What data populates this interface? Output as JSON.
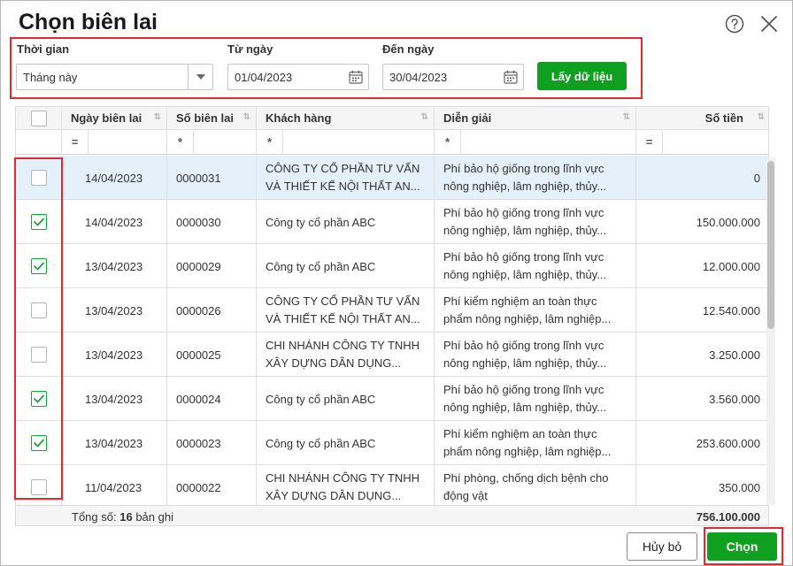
{
  "dialog": {
    "title": "Chọn biên lai",
    "help_icon": "help-circle-icon",
    "close_icon": "close-icon"
  },
  "filters": {
    "period_label": "Thời gian",
    "period_value": "Tháng này",
    "from_label": "Từ ngày",
    "from_value": "01/04/2023",
    "to_label": "Đến ngày",
    "to_value": "30/04/2023",
    "fetch_button": "Lấy dữ liệu"
  },
  "table": {
    "columns": [
      "Ngày biên lai",
      "Số biên lai",
      "Khách hàng",
      "Diễn giải",
      "Số tiền"
    ],
    "filter_ops": [
      "=",
      "*",
      "*",
      "*",
      "="
    ],
    "rows": [
      {
        "checked": false,
        "selected": true,
        "date": "14/04/2023",
        "number": "0000031",
        "customer": [
          "CÔNG TY CỔ PHẦN TƯ VẤN",
          "VÀ THIẾT KẾ NỘI THẤT AN..."
        ],
        "desc": [
          "Phí bảo hộ giống trong lĩnh vực",
          "nông nghiệp, lâm nghiệp, thủy..."
        ],
        "amount": "0"
      },
      {
        "checked": true,
        "selected": false,
        "date": "14/04/2023",
        "number": "0000030",
        "customer": [
          "Công ty cổ phần ABC"
        ],
        "desc": [
          "Phí bảo hộ giống trong lĩnh vực",
          "nông nghiệp, lâm nghiệp, thủy..."
        ],
        "amount": "150.000.000"
      },
      {
        "checked": true,
        "selected": false,
        "date": "13/04/2023",
        "number": "0000029",
        "customer": [
          "Công ty cổ phần ABC"
        ],
        "desc": [
          "Phí bảo hộ giống trong lĩnh vực",
          "nông nghiệp, lâm nghiệp, thủy..."
        ],
        "amount": "12.000.000"
      },
      {
        "checked": false,
        "selected": false,
        "date": "13/04/2023",
        "number": "0000026",
        "customer": [
          "CÔNG TY CỔ PHẦN TƯ VẤN",
          "VÀ THIẾT KẾ NỘI THẤT AN..."
        ],
        "desc": [
          "Phí kiểm nghiệm an toàn thực",
          "phẩm nông nghiệp, lâm nghiệp..."
        ],
        "amount": "12.540.000"
      },
      {
        "checked": false,
        "selected": false,
        "date": "13/04/2023",
        "number": "0000025",
        "customer": [
          "CHI NHÁNH CÔNG TY TNHH",
          "XÂY DỰNG DÂN DỤNG..."
        ],
        "desc": [
          "Phí bảo hộ giống trong lĩnh vực",
          "nông nghiệp, lâm nghiệp, thủy..."
        ],
        "amount": "3.250.000"
      },
      {
        "checked": true,
        "selected": false,
        "date": "13/04/2023",
        "number": "0000024",
        "customer": [
          "Công ty cổ phần ABC"
        ],
        "desc": [
          "Phí bảo hộ giống trong lĩnh vực",
          "nông nghiệp, lâm nghiệp, thủy..."
        ],
        "amount": "3.560.000"
      },
      {
        "checked": true,
        "selected": false,
        "date": "13/04/2023",
        "number": "0000023",
        "customer": [
          "Công ty cổ phần ABC"
        ],
        "desc": [
          "Phí kiểm nghiệm an toàn thực",
          "phẩm nông nghiệp, lâm nghiệp..."
        ],
        "amount": "253.600.000"
      },
      {
        "checked": false,
        "selected": false,
        "date": "11/04/2023",
        "number": "0000022",
        "customer": [
          "CHI NHÁNH CÔNG TY TNHH",
          "XÂY DỰNG DÂN DỤNG..."
        ],
        "desc": [
          "Phí phòng, chống dịch bệnh cho",
          "động vật"
        ],
        "amount": "350.000"
      }
    ],
    "footer": {
      "total_label": "Tổng số:",
      "total_count": "16",
      "total_suffix": "bản ghi",
      "total_amount": "756.100.000"
    }
  },
  "actions": {
    "cancel": "Hủy bỏ",
    "choose": "Chọn"
  },
  "colors": {
    "accent_green": "#0ea01e",
    "highlight_red": "#e02b35",
    "selected_row": "#e4f1fb"
  }
}
